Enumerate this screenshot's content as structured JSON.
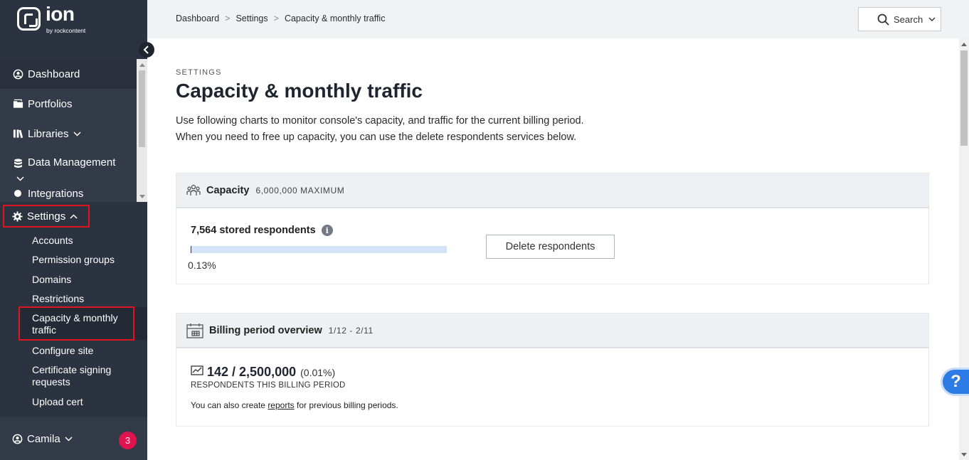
{
  "brand": {
    "name": "ion",
    "sub": "by rockcontent"
  },
  "sidebar": {
    "items": [
      {
        "label": "Dashboard",
        "icon": "dashboard-icon"
      },
      {
        "label": "Portfolios",
        "icon": "folder-icon"
      },
      {
        "label": "Libraries",
        "icon": "libraries-icon"
      },
      {
        "label": "Data Management",
        "icon": "database-icon"
      },
      {
        "label": "Integrations",
        "icon": "integrations-icon"
      }
    ],
    "settings": {
      "label": "Settings",
      "icon": "gear-icon",
      "subitems": [
        "Accounts",
        "Permission groups",
        "Domains",
        "Restrictions",
        "Capacity & monthly traffic",
        "Configure site",
        "Certificate signing requests",
        "Upload cert"
      ]
    },
    "user": {
      "name": "Camila",
      "badge": "3"
    }
  },
  "breadcrumb": [
    "Dashboard",
    "Settings",
    "Capacity & monthly traffic"
  ],
  "search": {
    "label": "Search"
  },
  "page": {
    "overline": "SETTINGS",
    "title": "Capacity & monthly traffic",
    "desc1": "Use following charts to monitor console's capacity, and traffic for the current billing period.",
    "desc2": "When you need to free up capacity, you can use the delete respondents services below."
  },
  "capacity": {
    "title": "Capacity",
    "max": "6,000,000 MAXIMUM",
    "stored": "7,564 stored respondents",
    "percent": "0.13%",
    "fill_fraction": 0.0013,
    "delete_label": "Delete respondents"
  },
  "billing": {
    "title": "Billing period overview",
    "period": "1/12 - 2/11",
    "count": "142 / 2,500,000",
    "percent": "(0.01%)",
    "label": "RESPONDENTS THIS BILLING PERIOD",
    "note_pre": "You can also create ",
    "note_link": "reports",
    "note_post": " for previous billing periods."
  },
  "help": {
    "label": "?"
  },
  "colors": {
    "sidebar": "#2c3340",
    "accent": "#2d7be5",
    "highlight": "#e0141e",
    "badge": "#e1134f"
  }
}
